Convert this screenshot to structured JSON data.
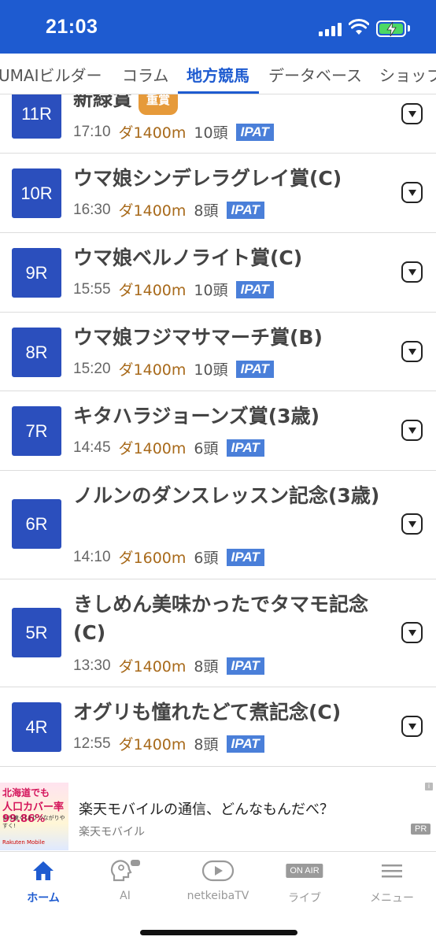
{
  "status_bar": {
    "time": "21:03"
  },
  "tabs": [
    {
      "label": "UMAIビルダー"
    },
    {
      "label": "コラム"
    },
    {
      "label": "地方競馬",
      "active": true
    },
    {
      "label": "データベース"
    },
    {
      "label": "ショップ"
    }
  ],
  "races": [
    {
      "number": "11R",
      "name": "新緑賞",
      "grade": "重賞",
      "time": "17:10",
      "course": "ダ1400m",
      "heads": "10頭",
      "ipat": "IPAT"
    },
    {
      "number": "10R",
      "name": "ウマ娘シンデレラグレイ賞(C)",
      "time": "16:30",
      "course": "ダ1400m",
      "heads": "8頭",
      "ipat": "IPAT"
    },
    {
      "number": "9R",
      "name": "ウマ娘ベルノライト賞(C)",
      "time": "15:55",
      "course": "ダ1400m",
      "heads": "10頭",
      "ipat": "IPAT"
    },
    {
      "number": "8R",
      "name": "ウマ娘フジマサマーチ賞(B)",
      "time": "15:20",
      "course": "ダ1400m",
      "heads": "10頭",
      "ipat": "IPAT"
    },
    {
      "number": "7R",
      "name": "キタハラジョーンズ賞(3歳)",
      "time": "14:45",
      "course": "ダ1400m",
      "heads": "6頭",
      "ipat": "IPAT"
    },
    {
      "number": "6R",
      "name": "ノルンのダンスレッスン記念(3歳)",
      "time": "14:10",
      "course": "ダ1600m",
      "heads": "6頭",
      "ipat": "IPAT"
    },
    {
      "number": "5R",
      "name": "きしめん美味かったでタマモ記念(C)",
      "time": "13:30",
      "course": "ダ1400m",
      "heads": "8頭",
      "ipat": "IPAT"
    },
    {
      "number": "4R",
      "name": "オグリも憧れたどて煮記念(C)",
      "time": "12:55",
      "course": "ダ1400m",
      "heads": "8頭",
      "ipat": "IPAT"
    }
  ],
  "ad": {
    "title": "楽天モバイルの通信、どんなもんだべ？",
    "source": "楽天モバイル",
    "pr": "PR",
    "info": "i",
    "image_text": [
      "北海道でも",
      "人口カバー率99.86%",
      "より速く!よりつながりやすく!",
      "Rakuten Mobile"
    ]
  },
  "nav": [
    {
      "label": "ホーム",
      "icon": "home-icon",
      "active": true
    },
    {
      "label": "AI",
      "icon": "ai-brain-icon"
    },
    {
      "label": "netkeibaTV",
      "icon": "play-tv-icon"
    },
    {
      "label": "ライブ",
      "icon": "on-air-icon",
      "badge": "ON AIR"
    },
    {
      "label": "メニュー",
      "icon": "hamburger-menu-icon"
    }
  ],
  "colors": {
    "brand": "#1e5bd0",
    "race_badge": "#2b4fbd",
    "course": "#a86a1b",
    "ipat": "#4a7fd9",
    "grade": "#e69a3a"
  }
}
